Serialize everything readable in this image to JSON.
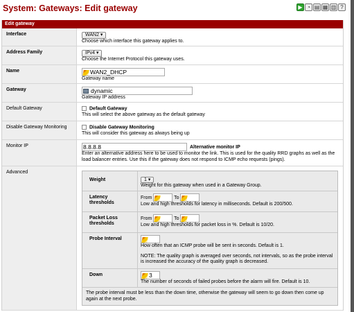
{
  "page": {
    "title": "System: Gateways: Edit gateway"
  },
  "header_icons": [
    {
      "name": "play-icon",
      "glyph": "▶"
    },
    {
      "name": "status-icon",
      "glyph": "◔"
    },
    {
      "name": "chart-icon",
      "glyph": "▤"
    },
    {
      "name": "log-icon",
      "glyph": "▦"
    },
    {
      "name": "list-icon",
      "glyph": "▥"
    },
    {
      "name": "help-icon",
      "glyph": "?"
    }
  ],
  "section": {
    "title": "Edit gateway"
  },
  "interface": {
    "label": "Interface",
    "value": "WAN2",
    "help": "Choose which interface this gateway applies to."
  },
  "address_family": {
    "label": "Address Family",
    "value": "IPv4",
    "help": "Choose the Internet Protocol this gateway uses."
  },
  "name": {
    "label": "Name",
    "value": "WAN2_DHCP",
    "help": "Gateway name"
  },
  "gateway": {
    "label": "Gateway",
    "value": "dynamic",
    "help": "Gateway IP address"
  },
  "default_gateway": {
    "label": "Default Gateway",
    "checkbox_label": "Default Gateway",
    "help": "This will select the above gateway as the default gateway"
  },
  "disable_monitoring": {
    "label": "Disable Gateway Monitoring",
    "checkbox_label": "Disable Gateway Monitoring",
    "help": "This will consider this gateway as always being up"
  },
  "monitor_ip": {
    "label": "Monitor IP",
    "value": "8.8.8.8",
    "side_label": "Alternative monitor IP",
    "help": "Enter an alternative address here to be used to monitor the link. This is used for the quality RRD graphs as well as the load balancer entries. Use this if the gateway does not respond to ICMP echo requests (pings)."
  },
  "advanced": {
    "label": "Advanced",
    "weight": {
      "label": "Weight",
      "value": "1",
      "help": "Weight for this gateway when used in a Gateway Group."
    },
    "latency": {
      "label": "Latency thresholds",
      "from": "From",
      "to": "To",
      "help": "Low and high thresholds for latency in milliseconds. Default is 200/500."
    },
    "packet_loss": {
      "label": "Packet Loss thresholds",
      "from": "From",
      "to": "To",
      "help": "Low and high thresholds for packet loss in %. Default is 10/20."
    },
    "probe_interval": {
      "label": "Probe Interval",
      "help": "How often that an ICMP probe will be sent in seconds. Default is 1.",
      "note": "NOTE: The quality graph is averaged over seconds, not intervals, so as the probe interval is increased the accuracy of the quality graph is decreased."
    },
    "down": {
      "label": "Down",
      "value": "3",
      "help": "The number of seconds of failed probes before the alarm will fire. Default is 10."
    },
    "footer": "The probe interval must be less than the down time, otherwise the gateway will seem to go down then come up again at the next probe."
  }
}
